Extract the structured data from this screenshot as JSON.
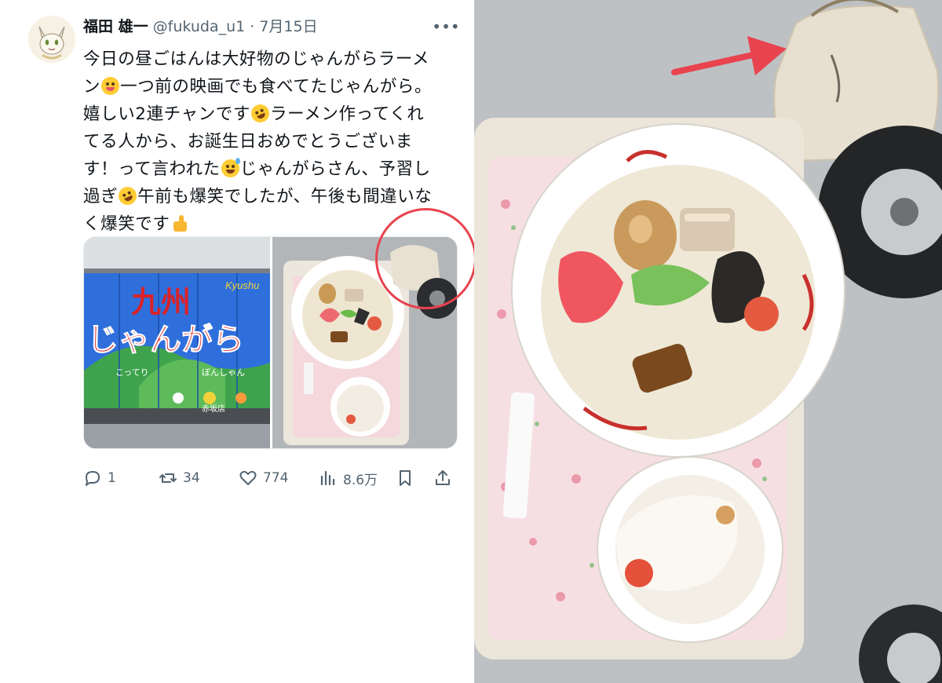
{
  "tweet": {
    "author_name": "福田 雄一",
    "handle": "@fukuda_u1",
    "separator": "·",
    "date": "7月15日",
    "text_lines": [
      [
        "今日の昼ごはんは大好物のじゃんがらラーメ"
      ],
      [
        "ン",
        "一つ前の映画でも食べてたじゃんがら。"
      ],
      [
        "嬉しい2連チャンです",
        "ラーメン作ってくれ"
      ],
      [
        "てる人から、お誕生日おめでとうございま"
      ],
      [
        "す！って言われた",
        "じゃんがらさん、予習し"
      ],
      [
        "過ぎ",
        "午前も爆笑でしたが、午後も間違いな"
      ],
      [
        "く爆笑です"
      ]
    ],
    "emojis": [
      "yum-emoji",
      "rofl-emoji",
      "sweat-smile-emoji",
      "rofl-emoji",
      "thumbs-up-emoji"
    ],
    "media": {
      "left_photo": {
        "banner_text_top": "九州",
        "banner_text_main": "じゃんがら",
        "banner_text_kyushu": "Kyushu",
        "banner_small_labels": [
          "こってり",
          "ぼんしゃん",
          "赤坂店"
        ]
      },
      "right_photo": "ramen-tray-photo"
    },
    "reactions": {
      "replies": "1",
      "retweets": "34",
      "likes": "774",
      "views": "8.6万"
    }
  },
  "annotation": {
    "circle_color": "#e8434f",
    "arrow_color": "#e8434f"
  },
  "zoom_photo": {
    "description_icon": "ramen-tray-photo-zoomed"
  },
  "colors": {
    "text_primary": "#0f1419",
    "text_secondary": "#536471",
    "accent_red": "#e8434f",
    "banner_blue": "#2f6fdc",
    "banner_red": "#d8232a"
  }
}
